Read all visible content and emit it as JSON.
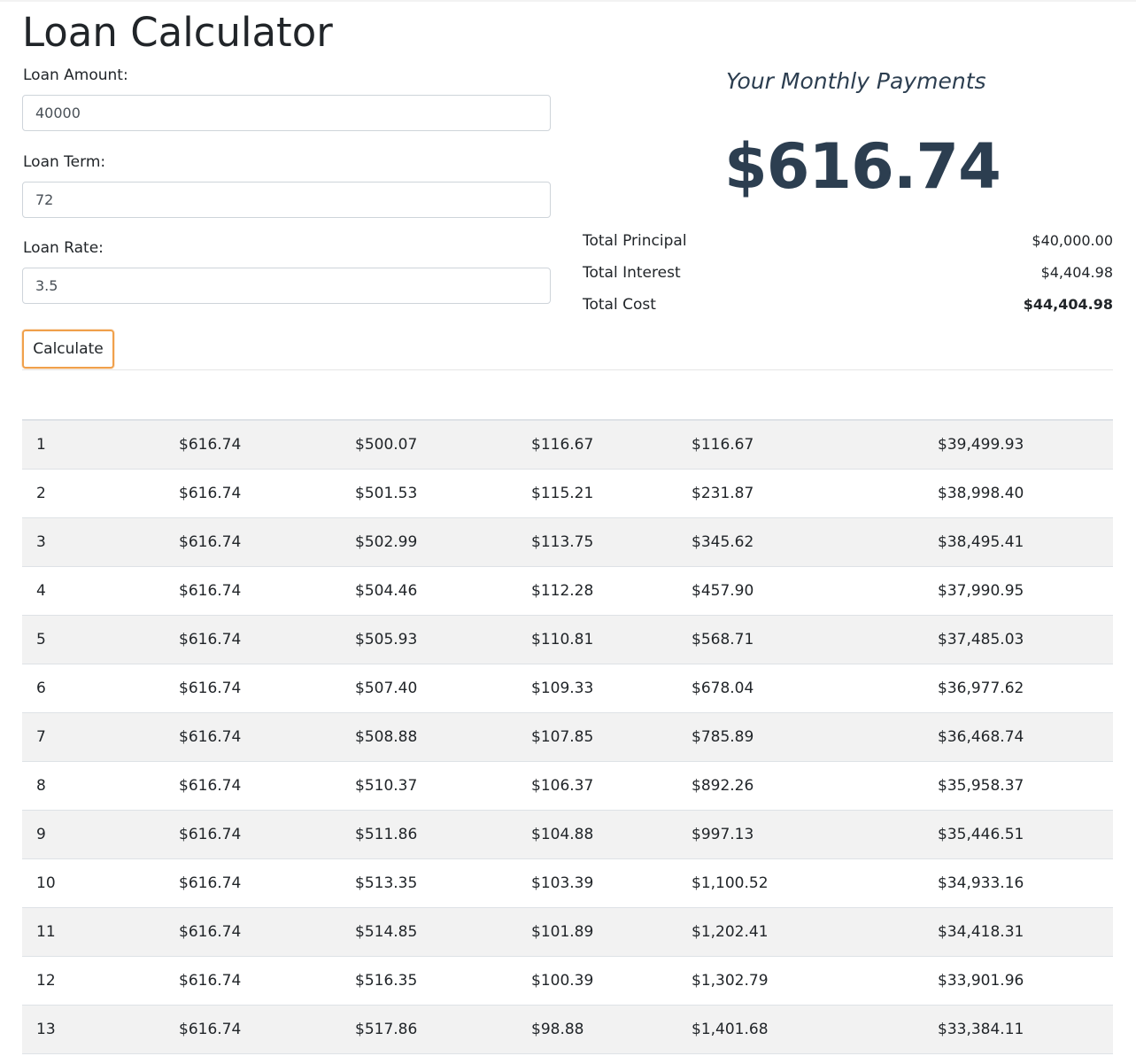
{
  "title": "Loan Calculator",
  "form": {
    "amount_label": "Loan Amount:",
    "amount_value": "40000",
    "term_label": "Loan Term:",
    "term_value": "72",
    "rate_label": "Loan Rate:",
    "rate_value": "3.5",
    "calculate_label": "Calculate",
    "accent_color": "#f0a04b"
  },
  "result": {
    "caption": "Your Monthly Payments",
    "monthly_payment": "$616.74",
    "total_principal_label": "Total Principal",
    "total_principal": "$40,000.00",
    "total_interest_label": "Total Interest",
    "total_interest": "$4,404.98",
    "total_cost_label": "Total Cost",
    "total_cost": "$44,404.98",
    "accent_color": "#2c3e50"
  },
  "schedule": {
    "rows": [
      [
        "1",
        "$616.74",
        "$500.07",
        "$116.67",
        "$116.67",
        "$39,499.93"
      ],
      [
        "2",
        "$616.74",
        "$501.53",
        "$115.21",
        "$231.87",
        "$38,998.40"
      ],
      [
        "3",
        "$616.74",
        "$502.99",
        "$113.75",
        "$345.62",
        "$38,495.41"
      ],
      [
        "4",
        "$616.74",
        "$504.46",
        "$112.28",
        "$457.90",
        "$37,990.95"
      ],
      [
        "5",
        "$616.74",
        "$505.93",
        "$110.81",
        "$568.71",
        "$37,485.03"
      ],
      [
        "6",
        "$616.74",
        "$507.40",
        "$109.33",
        "$678.04",
        "$36,977.62"
      ],
      [
        "7",
        "$616.74",
        "$508.88",
        "$107.85",
        "$785.89",
        "$36,468.74"
      ],
      [
        "8",
        "$616.74",
        "$510.37",
        "$106.37",
        "$892.26",
        "$35,958.37"
      ],
      [
        "9",
        "$616.74",
        "$511.86",
        "$104.88",
        "$997.13",
        "$35,446.51"
      ],
      [
        "10",
        "$616.74",
        "$513.35",
        "$103.39",
        "$1,100.52",
        "$34,933.16"
      ],
      [
        "11",
        "$616.74",
        "$514.85",
        "$101.89",
        "$1,202.41",
        "$34,418.31"
      ],
      [
        "12",
        "$616.74",
        "$516.35",
        "$100.39",
        "$1,302.79",
        "$33,901.96"
      ],
      [
        "13",
        "$616.74",
        "$517.86",
        "$98.88",
        "$1,401.68",
        "$33,384.11"
      ]
    ]
  }
}
